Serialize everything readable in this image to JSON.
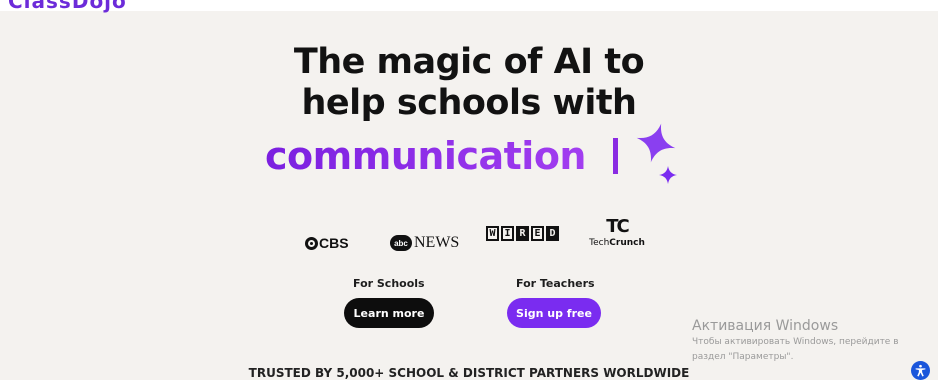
{
  "header": {
    "logo_text": "ClassDojo"
  },
  "hero": {
    "headline_line1": "The magic of AI to",
    "headline_line2": "help schools with",
    "rotating_word": "communication"
  },
  "press": {
    "cbs": "CBS",
    "abc_badge": "abc",
    "abc_news": "NEWS",
    "wired_letters": [
      "W",
      "I",
      "R",
      "E",
      "D"
    ],
    "tc_mark": "TC",
    "tc_word_light": "Tech",
    "tc_word_bold": "Crunch"
  },
  "cta": {
    "schools_label": "For Schools",
    "schools_button": "Learn more",
    "teachers_label": "For Teachers",
    "teachers_button": "Sign up free"
  },
  "trusted": {
    "text": "TRUSTED BY 5,000+ SCHOOL & DISTRICT PARTNERS WORLDWIDE"
  },
  "windows_watermark": {
    "title": "Активация Windows",
    "line1": "Чтобы активировать Windows, перейдите в",
    "line2": "раздел \"Параметры\"."
  },
  "colors": {
    "accent": "#7a2cf0",
    "background": "#f4f2ef",
    "dark_button": "#0d0d0d"
  },
  "icons": {
    "sparkle": "sparkle-icon",
    "accessibility": "accessibility-icon"
  }
}
